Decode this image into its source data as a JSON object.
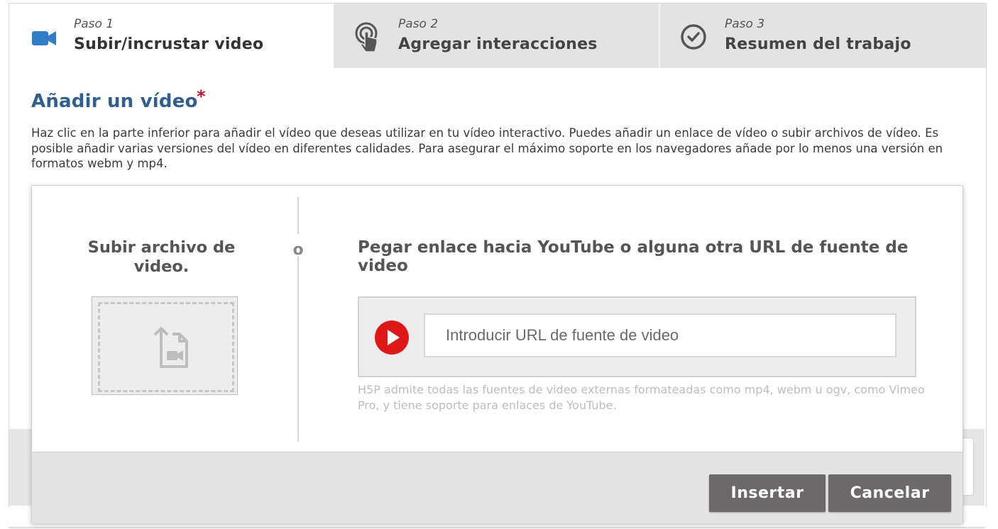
{
  "tabs": [
    {
      "step": "Paso 1",
      "label": "Subir/incrustar video",
      "icon": "video-camera-icon",
      "active": true
    },
    {
      "step": "Paso 2",
      "label": "Agregar interacciones",
      "icon": "touch-pointer-icon",
      "active": false
    },
    {
      "step": "Paso 3",
      "label": "Resumen del trabajo",
      "icon": "check-circle-icon",
      "active": false
    }
  ],
  "section": {
    "title": "Añadir un vídeo",
    "required_mark": "*",
    "description": "Haz clic en la parte inferior para añadir el vídeo que deseas utilizar en tu vídeo interactivo. Puedes añadir un enlace de vídeo o subir archivos de vídeo. Es posible añadir varias versiones del vídeo en diferentes calidades. Para asegurar el máximo soporte en los navegadores añade por lo menos una versión en formatos webm y mp4."
  },
  "dialog": {
    "upload_title": "Subir archivo de video.",
    "or_label": "o",
    "url_title": "Pegar enlace hacia YouTube o alguna otra URL de fuente de video",
    "url_placeholder": "Introducir URL de fuente de video",
    "url_value": "",
    "hint": "H5P admite todas las fuentes de video externas formateadas como mp4, webm u ogv, como Vimeo Pro, y tiene soporte para enlaces de YouTube.",
    "insert_label": "Insertar",
    "cancel_label": "Cancelar"
  },
  "colors": {
    "accent_blue": "#2f5f8f",
    "video_icon_blue": "#2f7dc8",
    "required_red": "#c8102e",
    "youtube_red": "#e01717",
    "button_gray": "#6d686a"
  }
}
